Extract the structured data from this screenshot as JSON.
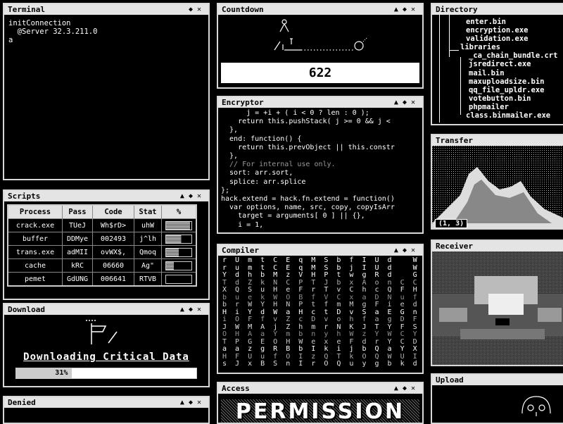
{
  "windows": {
    "terminal": {
      "title": "Terminal",
      "lines": [
        "initConnection",
        "  @Server 32.3.211.0",
        "a"
      ]
    },
    "scripts": {
      "title": "Scripts",
      "headers": [
        "Process",
        "Pass",
        "Code",
        "Stat",
        "%"
      ],
      "rows": [
        {
          "process": "crack.exe",
          "pass": "TUeJ",
          "code": "Wh$rD>",
          "stat": "uhW",
          "pct": 0.95
        },
        {
          "process": "buffer",
          "pass": "DDMye",
          "code": "002493",
          "stat": "j^lh",
          "pct": 0.6
        },
        {
          "process": "trans.exe",
          "pass": "adMII",
          "code": "ovWX$,",
          "stat": "Qmoq",
          "pct": 0.5
        },
        {
          "process": "cache",
          "pass": "kRC",
          "code": "06660",
          "stat": "Ag\"",
          "pct": 0.3
        },
        {
          "process": "pemet",
          "pass": "GdUNG",
          "code": "006641",
          "stat": "RTVB",
          "pct": 0.0
        }
      ]
    },
    "download": {
      "title": "Download",
      "heading": "Downloading Critical Data",
      "progress_label": "31%",
      "progress": 0.31
    },
    "denied": {
      "title": "Denied"
    },
    "countdown": {
      "title": "Countdown",
      "value": "622"
    },
    "encryptor": {
      "title": "Encryptor",
      "lines": [
        "      j = +i + ( i < 0 ? len : 0 );",
        "    return this.pushStack( j >= 0 && j <",
        "  },",
        "  end: function() {",
        "    return this.prevObject || this.constr",
        "  },",
        "  // For internal use only.",
        "  sort: arr.sort,",
        "  splice: arr.splice",
        "};",
        "hack.extend = hack.fn.extend = function()",
        "  var options, name, src, copy, copyIsArr",
        "    target = arguments[ 0 ] || {},",
        "    i = 1,"
      ]
    },
    "compiler": {
      "title": "Compiler",
      "lines": [
        "r U m t C E q M S b f I U d   W P v v y B",
        "r u m t C E q M S b j I U d   W P v v y B",
        "Y d h b M z V H P t w g R d   G X J d m B",
        "T d Z k N C P T J b x A o n C C X n G c S",
        "X Q S u H e F r T v C h c Q F H W r Y H R",
        "b u e k W O B f V C x a D N u f e L m H B",
        "b r W Y H N P t f m M g F i e d J r P H G",
        "H i Y d W a H c t D v S a E G n C f m H n",
        "i O F f v Z c D v o h f a g D F C L b R P",
        "J W M A j Z h m r N K J T Y F S a W F j h",
        "O H A a Y m b n y h W z Y W C Y D X a f l",
        "T P G E O H W e x e F d r Y C D j M W r x",
        "a a z g R B b I k i j b Q a Y X U W i Y J",
        "H F U u f O I z Q T k O Q W U I D B D P w",
        "s J x B S n I r O Q u y g b k d L b B q W"
      ]
    },
    "access": {
      "title": "Access",
      "text": "PERMISSION"
    },
    "directory": {
      "title": "Directory",
      "items": [
        "enter.bin",
        "encryption.exe",
        "validation.exe",
        "libraries",
        "_ca_chain_bundle.crt",
        "jsredirect.exe",
        "mail.bin",
        "maxuploadsize.bin",
        "qq_file_upldr.exe",
        "votebutton.bin",
        "phpmailer",
        "class.binmailer.exe"
      ]
    },
    "transfer": {
      "title": "Transfer",
      "coord": "(1, 3)"
    },
    "receiver": {
      "title": "Receiver"
    },
    "upload": {
      "title": "Upload"
    }
  },
  "controls": {
    "up": "▲",
    "resize": "◆",
    "close": "✕"
  }
}
